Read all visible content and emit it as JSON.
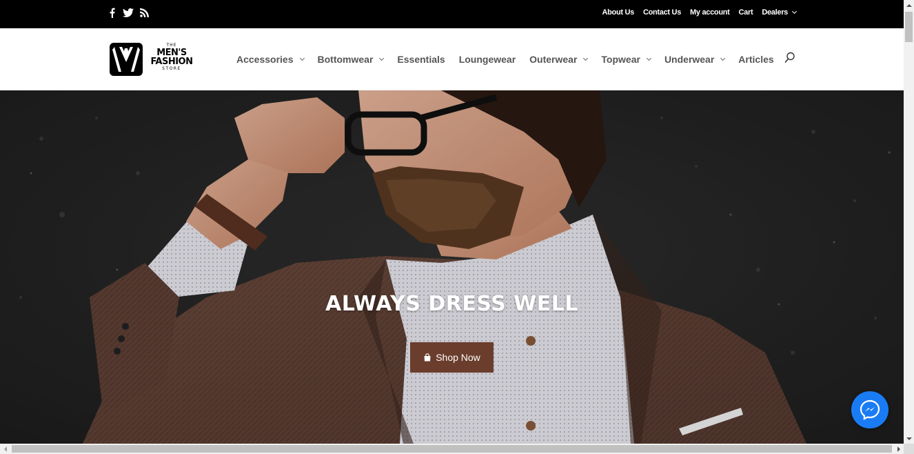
{
  "topbar": {
    "social": [
      {
        "icon": "facebook-icon"
      },
      {
        "icon": "twitter-icon"
      },
      {
        "icon": "rss-icon"
      }
    ],
    "links": {
      "about": "About Us",
      "contact": "Contact Us",
      "account": "My account",
      "cart": "Cart",
      "dealers": "Dealers"
    }
  },
  "brand": {
    "line1": "THE",
    "line2": "MEN'S",
    "line3": "FASHION",
    "line4": "STORE"
  },
  "nav": {
    "accessories": "Accessories",
    "bottomwear": "Bottomwear",
    "essentials": "Essentials",
    "loungewear": "Loungewear",
    "outerwear": "Outerwear",
    "topwear": "Topwear",
    "underwear": "Underwear",
    "articles": "Articles",
    "search_icon": "search-icon"
  },
  "hero": {
    "headline": "ALWAYS DRESS WELL",
    "cta_label": "Shop Now",
    "cta_icon": "shopping-bag-icon"
  },
  "messenger": {
    "icon": "messenger-icon"
  },
  "colors": {
    "topbar_bg": "#000000",
    "nav_text": "#555555",
    "cta_bg": "#6b3d2c",
    "messenger_bg": "#1a7cf5"
  }
}
